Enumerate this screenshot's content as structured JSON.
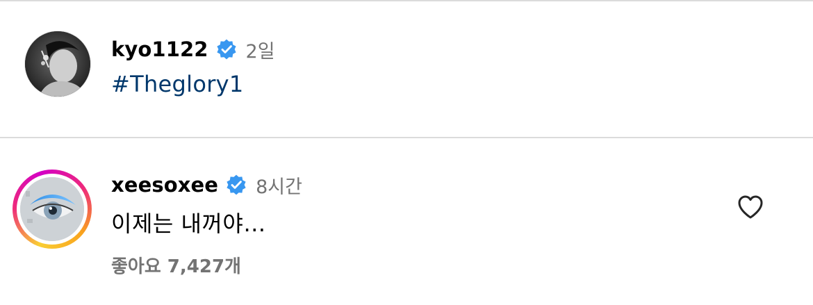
{
  "caption": {
    "username": "kyo1122",
    "verified": true,
    "time": "2일",
    "text": "#Theglory1"
  },
  "comment": {
    "username": "xeesoxee",
    "verified": true,
    "time": "8시간",
    "text": "이제는 내꺼야…",
    "likes_label": "좋아요 7,427개",
    "like_icon": "heart-outline-icon"
  },
  "colors": {
    "verified_blue": "#3897f0",
    "hashtag": "#00376b",
    "secondary_text": "#737373",
    "divider": "#dbdbdb"
  }
}
